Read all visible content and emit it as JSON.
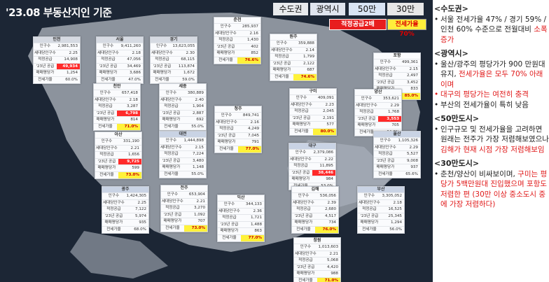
{
  "title": "'23.08 부동산지인 기준",
  "legend": {
    "metro": "수도권",
    "city": "광역시",
    "c50": "50만",
    "c30": "30만",
    "supply": "적정공급2배",
    "jeonse": "전세가율70%"
  },
  "row_labels": [
    "인구수",
    "세대당인구수",
    "적정공급",
    "'23년 공급",
    "매매평당가",
    "전세가율"
  ],
  "cards": [
    {
      "name": "인천",
      "type": "metro",
      "values": [
        "2,981,553",
        "2.25",
        "14,908",
        "49,934",
        "1,254",
        "60.0%"
      ],
      "hl": {
        "3": "red"
      }
    },
    {
      "name": "서울",
      "type": "metro",
      "values": [
        "9,411,260",
        "2.18",
        "47,056",
        "34,469",
        "3,686",
        "47.0%"
      ],
      "hl": {}
    },
    {
      "name": "경기",
      "type": "metro",
      "values": [
        "13,623,055",
        "2.30",
        "68,115",
        "113,874",
        "1,672",
        "59.0%"
      ],
      "hl": {}
    },
    {
      "name": "춘천",
      "type": "c30",
      "values": [
        "285,937",
        "2.16",
        "1,430",
        "402",
        "852",
        "76.6%"
      ],
      "hl": {
        "5": "yel"
      }
    },
    {
      "name": "원주",
      "type": "c30",
      "values": [
        "359,888",
        "2.14",
        "1,799",
        "2,122",
        "687",
        "74.6%"
      ],
      "hl": {
        "5": "yel"
      }
    },
    {
      "name": "포항",
      "type": "c50",
      "values": [
        "499,361",
        "2.15",
        "2,497",
        "3,452",
        "833",
        "85.0%"
      ],
      "hl": {
        "5": "yel"
      }
    },
    {
      "name": "천안",
      "type": "c50",
      "values": [
        "657,418",
        "2.18",
        "3,287",
        "6,798",
        "814",
        "71.0%"
      ],
      "hl": {
        "3": "red",
        "5": "yel"
      }
    },
    {
      "name": "세종",
      "type": "c30",
      "values": [
        "380,889",
        "2.40",
        "1,904",
        "2,887",
        "692",
        "55.0%"
      ],
      "hl": {}
    },
    {
      "name": "청주",
      "type": "c50",
      "values": [
        "849,741",
        "2.16",
        "4,249",
        "7,045",
        "791",
        "77.0%"
      ],
      "hl": {
        "5": "yel"
      }
    },
    {
      "name": "구미",
      "type": "c30",
      "values": [
        "409,091",
        "2.23",
        "2,045",
        "2,191",
        "577",
        "80.0%"
      ],
      "hl": {
        "5": "yel"
      }
    },
    {
      "name": "양산",
      "type": "c30",
      "values": [
        "353,621",
        "2.29",
        "1,768",
        "3,553",
        "705",
        "64.3%"
      ],
      "hl": {
        "3": "red"
      }
    },
    {
      "name": "대전",
      "type": "city",
      "values": [
        "1,444,898",
        "2.15",
        "7,224",
        "3,480",
        "1,148",
        "55.0%"
      ],
      "hl": {}
    },
    {
      "name": "대구",
      "type": "city",
      "values": [
        "2,379,086",
        "2.22",
        "11,895",
        "38,446",
        "984",
        "53.0%"
      ],
      "hl": {
        "3": "red"
      }
    },
    {
      "name": "울산",
      "type": "city",
      "values": [
        "1,105,326",
        "2.29",
        "5,527",
        "9,008",
        "937",
        "65.6%"
      ],
      "hl": {}
    },
    {
      "name": "아산",
      "type": "c30",
      "values": [
        "331,190",
        "2.21",
        "1,656",
        "9,725",
        "599",
        "73.0%"
      ],
      "hl": {
        "3": "red",
        "5": "yel"
      }
    },
    {
      "name": "광주",
      "type": "city",
      "values": [
        "1,424,305",
        "2.25",
        "7,122",
        "5,974",
        "935",
        "68.0%"
      ],
      "hl": {}
    },
    {
      "name": "전주",
      "type": "c50",
      "values": [
        "653,904",
        "2.21",
        "3,270",
        "1,092",
        "707",
        "73.0%"
      ],
      "hl": {
        "5": "yel"
      }
    },
    {
      "name": "김해",
      "type": "c50",
      "values": [
        "536,056",
        "2.39",
        "2,680",
        "4,517",
        "734",
        "76.0%"
      ],
      "hl": {
        "5": "yel"
      }
    },
    {
      "name": "익산",
      "type": "c30",
      "values": [
        "344,133",
        "2.36",
        "1,721",
        "1,488",
        "863",
        "77.0%"
      ],
      "hl": {
        "5": "yel"
      }
    },
    {
      "name": "부산",
      "type": "city",
      "values": [
        "3,305,052",
        "2.18",
        "16,525",
        "25,345",
        "1,294",
        "56.0%"
      ],
      "hl": {}
    },
    {
      "name": "창원",
      "type": "c50",
      "values": [
        "1,013,603",
        "2.21",
        "5,068",
        "4,420",
        "988",
        "71.0%"
      ],
      "hl": {
        "5": "yel"
      }
    }
  ],
  "panel": {
    "s1": {
      "head": "<수도권>",
      "items": [
        {
          "t": "서울 전세가율 47% / 경기 59% / 인천 60% 수준으로 전월대비 ",
          "r": "소폭 증가"
        }
      ]
    },
    "s2": {
      "head": "<광역시>",
      "items": [
        {
          "t": "울산/광주의 평당가가 900 만원대 유지, ",
          "r": "전세가율은 모두 70% 아래이며"
        },
        {
          "t": "",
          "r": "대구의 평당가는 여전히 충격"
        },
        {
          "t": "부산의 전세가율이 특히 낮음",
          "r": ""
        }
      ]
    },
    "s3": {
      "head": "<50만도시>",
      "items": [
        {
          "t": "인구규모 및 전세가율을 고려하면 원래는 전주가 가장 저렴해보였으나 ",
          "r": "김해가 현재 시점 가장 저렴해보임"
        }
      ]
    },
    "s4": {
      "head": "<30만도시>",
      "items": [
        {
          "t": "춘천/양산이 비싸보이며, ",
          "r": "구미는 평당가 5백만원대 진입했으며 포항도 저렴한 편 (30만 이상 중소도시 중에 가장 저렴하다)"
        }
      ]
    }
  }
}
